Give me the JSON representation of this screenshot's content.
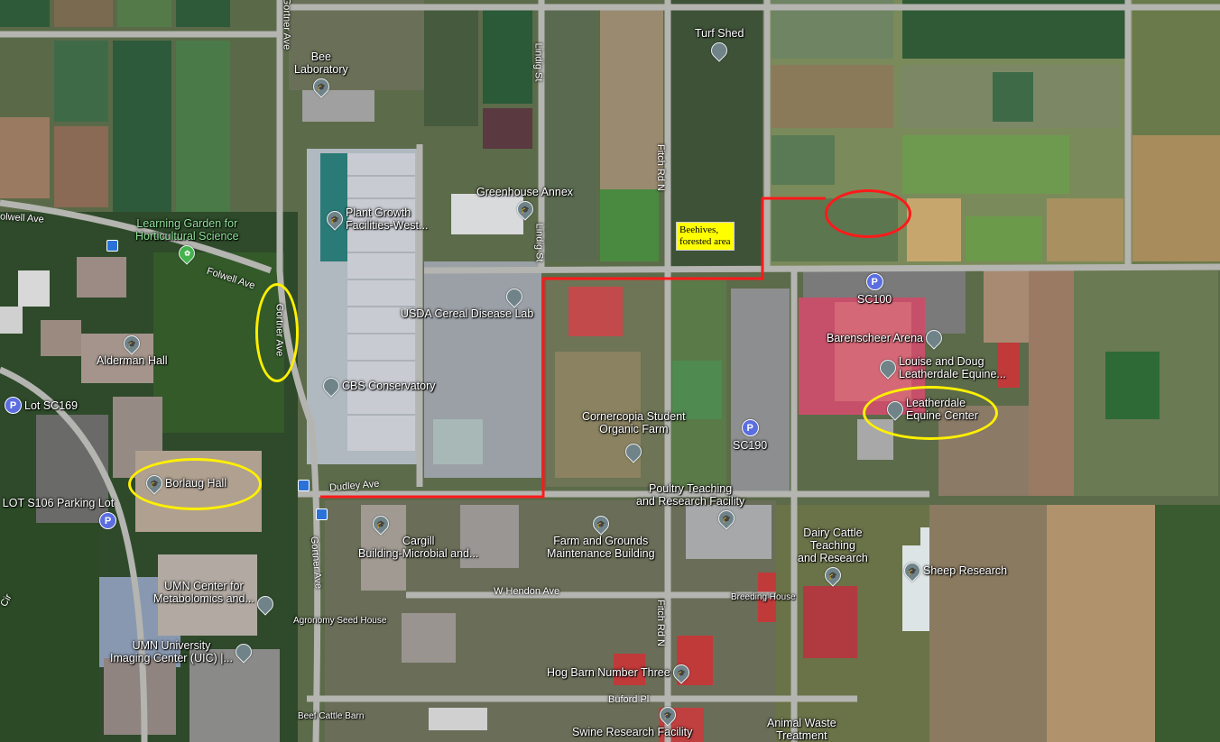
{
  "colors": {
    "route": "#ff1a1a",
    "highlight_yellow": "#fff000",
    "highlight_red": "#ff1a1a",
    "pin": "#6f8388",
    "parking": "#5b6ee0",
    "garden_pin": "#45b24e",
    "transit": "#2a72d8"
  },
  "roads": {
    "folwell_ave_left": "olwell Ave",
    "folwell_ave": "Folwell Ave",
    "gortner_ave_top": "Gortner Ave",
    "gortner_ave_mid": "Gortner Ave",
    "gortner_ave_bottom": "Gortner Ave",
    "lindig_st_top": "Lindig St",
    "lindig_st_mid": "Lindig St",
    "fitch_rd_top": "Fitch Rd N",
    "fitch_rd_bottom": "Fitch Rd N",
    "dudley_ave": "Dudley Ave",
    "w_hendon_ave": "W Hendon Ave",
    "buford_pl": "Buford Pl",
    "cir": "Cir"
  },
  "places": {
    "bee_lab": "Bee\nLaboratory",
    "turf_shed": "Turf Shed",
    "greenhouse_annex": "Greenhouse Annex",
    "plant_growth": "Plant Growth\nFacilities-West...",
    "learning_garden": "Learning Garden for\nHorticultural Science",
    "usda_lab": "USDA Cereal Disease Lab",
    "alderman_hall": "Alderman Hall",
    "cbs_conservatory": "CBS Conservatory",
    "cornercopia": "Cornercopia Student\nOrganic Farm",
    "borlaug_hall": "Borlaug Hall",
    "poultry": "Poultry Teaching\nand Research Facility",
    "cargill": "Cargill\nBuilding-Microbial and...",
    "farm_grounds": "Farm and Grounds\nMaintenance Building",
    "dairy_cattle": "Dairy Cattle\nTeaching\nand Research",
    "sheep_research": "Sheep Research",
    "breeding_house": "Breeding House",
    "umn_metabolomics": "UMN Center for\nMetabolomics and...",
    "agronomy_seed": "Agronomy Seed House",
    "umn_imaging": "UMN University\nImaging Center (UIC) |...",
    "hog_barn": "Hog Barn Number Three",
    "beef_cattle": "Beef Cattle Barn",
    "swine": "Swine Research Facility",
    "animal_waste": "Animal Waste\nTreatment",
    "barenscheer": "Barenscheer Arena",
    "leatherdale_doug": "Louise and Doug\nLeatherdale Equine...",
    "leatherdale_center": "Leatherdale\nEquine Center",
    "lot_s106": "LOT S106 Parking Lot"
  },
  "parking": {
    "sc100": "SC100",
    "sc190": "SC190",
    "lot_sc169": "Lot SC169"
  },
  "annotation": {
    "beehives": "Beehives,\nforested area"
  },
  "icons": {
    "pin_glyph": "🎓",
    "parking_glyph": "P"
  }
}
